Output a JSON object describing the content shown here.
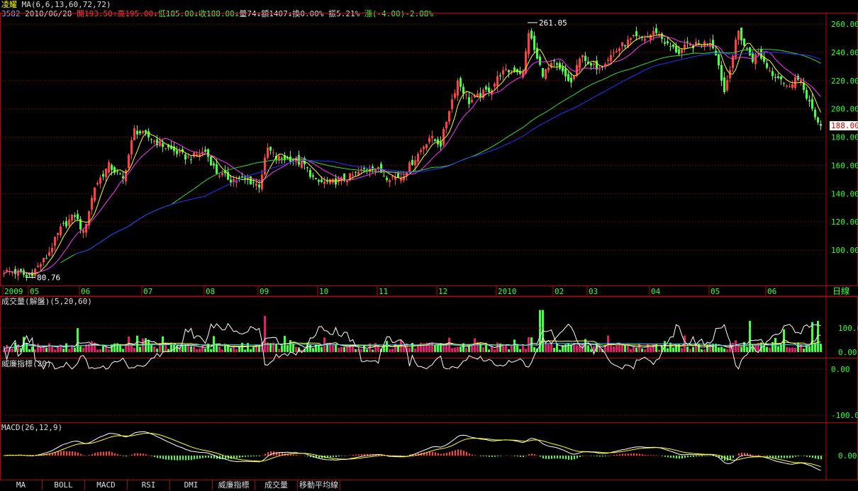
{
  "header": {
    "name": "凌耀",
    "ma_label": "MA(6,6,13,60,72,72)",
    "code": "3582",
    "date": "2010/06/28",
    "open": "開193.50↑",
    "high": "高195.00↓",
    "low": "低185.00↓",
    "close": "收188.00↓",
    "vol": "量74↓",
    "amount": "額1407↓",
    "turnover": "換0.00%",
    "amplitude": "振5.21%",
    "change": "漲(-4.00)-2.08%"
  },
  "colors": {
    "up": "#ff4040",
    "down": "#44ff44",
    "grid": "#c00000",
    "ma6": "#ffff00",
    "ma13": "#ff33ff",
    "ma60": "#33dd33",
    "ma72": "#2233ff"
  },
  "panels": {
    "volume_title": "成交量(解盤)(5,20,60)",
    "williams_title": "威廉指標(20)",
    "macd_title": "MACD(26,12,9)",
    "period": "日線"
  },
  "last_price": "188.00",
  "tabs": [
    "MA",
    "BOLL",
    "MACD",
    "RSI",
    "DMI",
    "威廉指標",
    "成交量",
    "移動平均線"
  ],
  "chart_data": {
    "type": "candlestick",
    "title": "凌耀 3582",
    "price_axis": {
      "ticks": [
        "260.00",
        "240.00",
        "220.00",
        "200.00",
        "180.00",
        "160.00",
        "140.00",
        "120.00",
        "100.00"
      ],
      "range": [
        78,
        265
      ]
    },
    "volume_axis": {
      "ticks": [
        "100.00",
        "0.00"
      ]
    },
    "williams_axis": {
      "ticks": [
        "0.00",
        "-100.0"
      ]
    },
    "macd_axis": {
      "ticks": [
        "0.00"
      ]
    },
    "x_labels": [
      [
        "2009",
        0
      ],
      [
        "05",
        9
      ],
      [
        "06",
        27
      ],
      [
        "07",
        49
      ],
      [
        "08",
        71
      ],
      [
        "09",
        90
      ],
      [
        "10",
        111
      ],
      [
        "11",
        132
      ],
      [
        "12",
        153
      ],
      [
        "2010",
        174
      ],
      [
        "02",
        194
      ],
      [
        "03",
        206
      ],
      [
        "04",
        228
      ],
      [
        "05",
        249
      ],
      [
        "06",
        269
      ]
    ],
    "annotations": [
      {
        "text": "261.05",
        "day": 185,
        "price": 261.05
      },
      {
        "text": "80.76",
        "day": 8,
        "price": 80.76
      }
    ],
    "close_keypoints": [
      [
        0,
        85
      ],
      [
        6,
        84
      ],
      [
        8,
        81
      ],
      [
        10,
        84
      ],
      [
        15,
        95
      ],
      [
        20,
        115
      ],
      [
        25,
        125
      ],
      [
        28,
        112
      ],
      [
        32,
        145
      ],
      [
        37,
        160
      ],
      [
        42,
        150
      ],
      [
        46,
        185
      ],
      [
        51,
        180
      ],
      [
        55,
        175
      ],
      [
        60,
        170
      ],
      [
        65,
        165
      ],
      [
        71,
        170
      ],
      [
        75,
        155
      ],
      [
        80,
        150
      ],
      [
        85,
        150
      ],
      [
        90,
        146
      ],
      [
        93,
        172
      ],
      [
        96,
        165
      ],
      [
        101,
        165
      ],
      [
        106,
        160
      ],
      [
        110,
        148
      ],
      [
        115,
        148
      ],
      [
        120,
        150
      ],
      [
        125,
        155
      ],
      [
        130,
        160
      ],
      [
        135,
        152
      ],
      [
        140,
        152
      ],
      [
        145,
        165
      ],
      [
        150,
        180
      ],
      [
        154,
        175
      ],
      [
        157,
        200
      ],
      [
        160,
        220
      ],
      [
        164,
        205
      ],
      [
        168,
        210
      ],
      [
        172,
        215
      ],
      [
        175,
        225
      ],
      [
        180,
        228
      ],
      [
        183,
        225
      ],
      [
        185,
        255
      ],
      [
        188,
        235
      ],
      [
        190,
        225
      ],
      [
        194,
        232
      ],
      [
        197,
        225
      ],
      [
        200,
        218
      ],
      [
        204,
        240
      ],
      [
        206,
        230
      ],
      [
        210,
        230
      ],
      [
        213,
        236
      ],
      [
        218,
        245
      ],
      [
        222,
        250
      ],
      [
        226,
        250
      ],
      [
        230,
        255
      ],
      [
        234,
        245
      ],
      [
        238,
        240
      ],
      [
        241,
        245
      ],
      [
        245,
        245
      ],
      [
        249,
        248
      ],
      [
        251,
        240
      ],
      [
        254,
        212
      ],
      [
        256,
        230
      ],
      [
        259,
        255
      ],
      [
        261,
        245
      ],
      [
        264,
        235
      ],
      [
        266,
        240
      ],
      [
        269,
        230
      ],
      [
        271,
        225
      ],
      [
        274,
        222
      ],
      [
        276,
        215
      ],
      [
        279,
        222
      ],
      [
        281,
        218
      ],
      [
        284,
        205
      ],
      [
        286,
        192
      ],
      [
        288,
        188
      ]
    ],
    "volume_spikes": [
      [
        26,
        100
      ],
      [
        92,
        150
      ],
      [
        189,
        175
      ],
      [
        190,
        175
      ],
      [
        285,
        125
      ],
      [
        287,
        130
      ],
      [
        263,
        130
      ],
      [
        275,
        95
      ]
    ]
  }
}
